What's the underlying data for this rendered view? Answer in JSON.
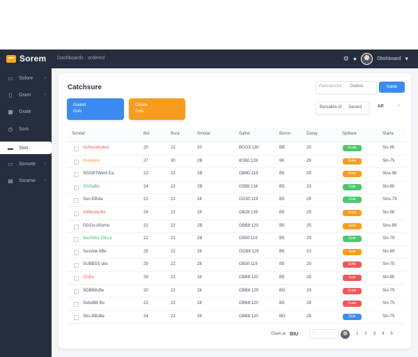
{
  "app": {
    "name": "Sorem",
    "breadcrumb": "Dashboards · ordered",
    "user_name": "Dbshboard"
  },
  "colors": {
    "sidebar": "#262d3d",
    "primary": "#3d8bf0",
    "accent": "#f79c1f",
    "success": "#4cc76e",
    "danger": "#f0575a"
  },
  "sidebar": {
    "items": [
      {
        "label": "Solore",
        "icon": "doc-icon",
        "glyph": "▭",
        "chevron": "›"
      },
      {
        "label": "Gram",
        "icon": "clipboard-icon",
        "glyph": "▯",
        "chevron": "›"
      },
      {
        "label": "Grate",
        "icon": "grid-icon",
        "glyph": "▦",
        "chevron": ""
      },
      {
        "label": "Som",
        "icon": "clock-icon",
        "glyph": "◷",
        "chevron": ""
      },
      {
        "label": "Sios",
        "icon": "card-icon",
        "glyph": "▬",
        "chevron": ""
      },
      {
        "label": "Sorsote",
        "icon": "folder-icon",
        "glyph": "▭",
        "chevron": "›"
      },
      {
        "label": "Ssrame",
        "icon": "table-icon",
        "glyph": "▤",
        "chevron": "›"
      }
    ]
  },
  "main": {
    "title": "Catchsure",
    "search_placeholder": "Pamrdsrcho",
    "search_value": "Oodres",
    "button_label": "Soble",
    "stats": [
      {
        "line1": "Goaret",
        "line2": "Gols"
      },
      {
        "line1": "Gmete",
        "line2": "Gols"
      }
    ],
    "filter_label": "Borsabre-of",
    "filter_value": "Sanerd",
    "select_value": "Aff",
    "select_chevron": "↕"
  },
  "table": {
    "headers": [
      "Sorelal",
      "Bol",
      "Bura",
      "Smolar",
      "Satrel",
      "Boron",
      "Daray",
      "Sptitare",
      "Starte"
    ],
    "rows": [
      {
        "name": "SoRerafeated",
        "c": "red",
        "v": [
          "20",
          "22",
          "20",
          "BGG3:130",
          "BB",
          "20"
        ],
        "status": "Grale",
        "b": "green",
        "end": "Sis-95"
      },
      {
        "name": "Gusbeon",
        "c": "orange",
        "v": [
          "27",
          "30",
          "2B",
          "8GB0:128",
          "86",
          "28"
        ],
        "status": "Dohe",
        "b": "orange",
        "end": "Sin-75"
      },
      {
        "name": "SGGBTWerd Ea",
        "c": "dark",
        "v": [
          "23",
          "22",
          "2B",
          "GB8D:119",
          "B5",
          "29"
        ],
        "status": "Sone",
        "b": "orange",
        "end": "Sins-98"
      },
      {
        "name": "SGGdBe",
        "c": "green",
        "v": [
          "24",
          "22",
          "2B",
          "G5B8:134",
          "B5",
          "23"
        ],
        "status": "Cale",
        "b": "green",
        "end": "Sin-85"
      },
      {
        "name": "Soo EBsta",
        "c": "dark",
        "v": [
          "22",
          "22",
          "28",
          "GG30:119",
          "B5",
          "28"
        ],
        "status": "Cole",
        "b": "green",
        "end": "Sins-79"
      },
      {
        "name": "SdBecbisBe",
        "c": "red",
        "v": [
          "28",
          "22",
          "28",
          "GB28:139",
          "B5",
          "29"
        ],
        "status": "Cone",
        "b": "orange",
        "end": "Sin-56"
      },
      {
        "name": "GGGo-dSomo",
        "c": "dark",
        "v": [
          "22",
          "22",
          "2B",
          "GBB8:129",
          "B5",
          "25"
        ],
        "status": "Geto",
        "b": "orange",
        "end": "Sins-89"
      },
      {
        "name": "SusSdss Gbo e",
        "c": "green",
        "v": [
          "22",
          "22",
          "2B",
          "G5B0:119",
          "B5",
          "29"
        ],
        "status": "Dote",
        "b": "green",
        "end": "Sin-79"
      },
      {
        "name": "Sussbie bBe",
        "c": "dark",
        "v": [
          "25",
          "22",
          "28",
          "GGB8:129",
          "B5",
          "23"
        ],
        "status": "Sole",
        "b": "orange",
        "end": "Sin-89"
      },
      {
        "name": "SUBBSS sbo",
        "c": "dark",
        "v": [
          "29",
          "22",
          "28",
          "GB30:119",
          "B5",
          "29"
        ],
        "status": "Sohe",
        "b": "red",
        "end": "Sin-75"
      },
      {
        "name": "SGBo",
        "c": "red",
        "v": [
          "26",
          "22",
          "28",
          "GBB8:120",
          "B5",
          "28"
        ],
        "status": "Gale",
        "b": "red",
        "end": "Sin-85"
      },
      {
        "name": "SGBB8sBe",
        "c": "dark",
        "v": [
          "20",
          "22",
          "28",
          "GBB8:129",
          "BG",
          "23"
        ],
        "status": "Drale",
        "b": "red",
        "end": "Sin-75"
      },
      {
        "name": "SoboBB Bo",
        "c": "dark",
        "v": [
          "22",
          "22",
          "28",
          "GBB8:120",
          "B5",
          "29"
        ],
        "status": "Cuse",
        "b": "red",
        "end": "Sin-75"
      },
      {
        "name": "Sbu-BBsBe",
        "c": "dark",
        "v": [
          "24",
          "22",
          "28",
          "GBB8:120",
          "BG",
          "28"
        ],
        "status": "Dole",
        "b": "blue",
        "end": "Sin-75"
      }
    ]
  },
  "pagination": {
    "label": "Gouk at",
    "size": "BIU",
    "prev": "‹",
    "pages": [
      "1",
      "2",
      "3",
      "4",
      "5"
    ]
  }
}
